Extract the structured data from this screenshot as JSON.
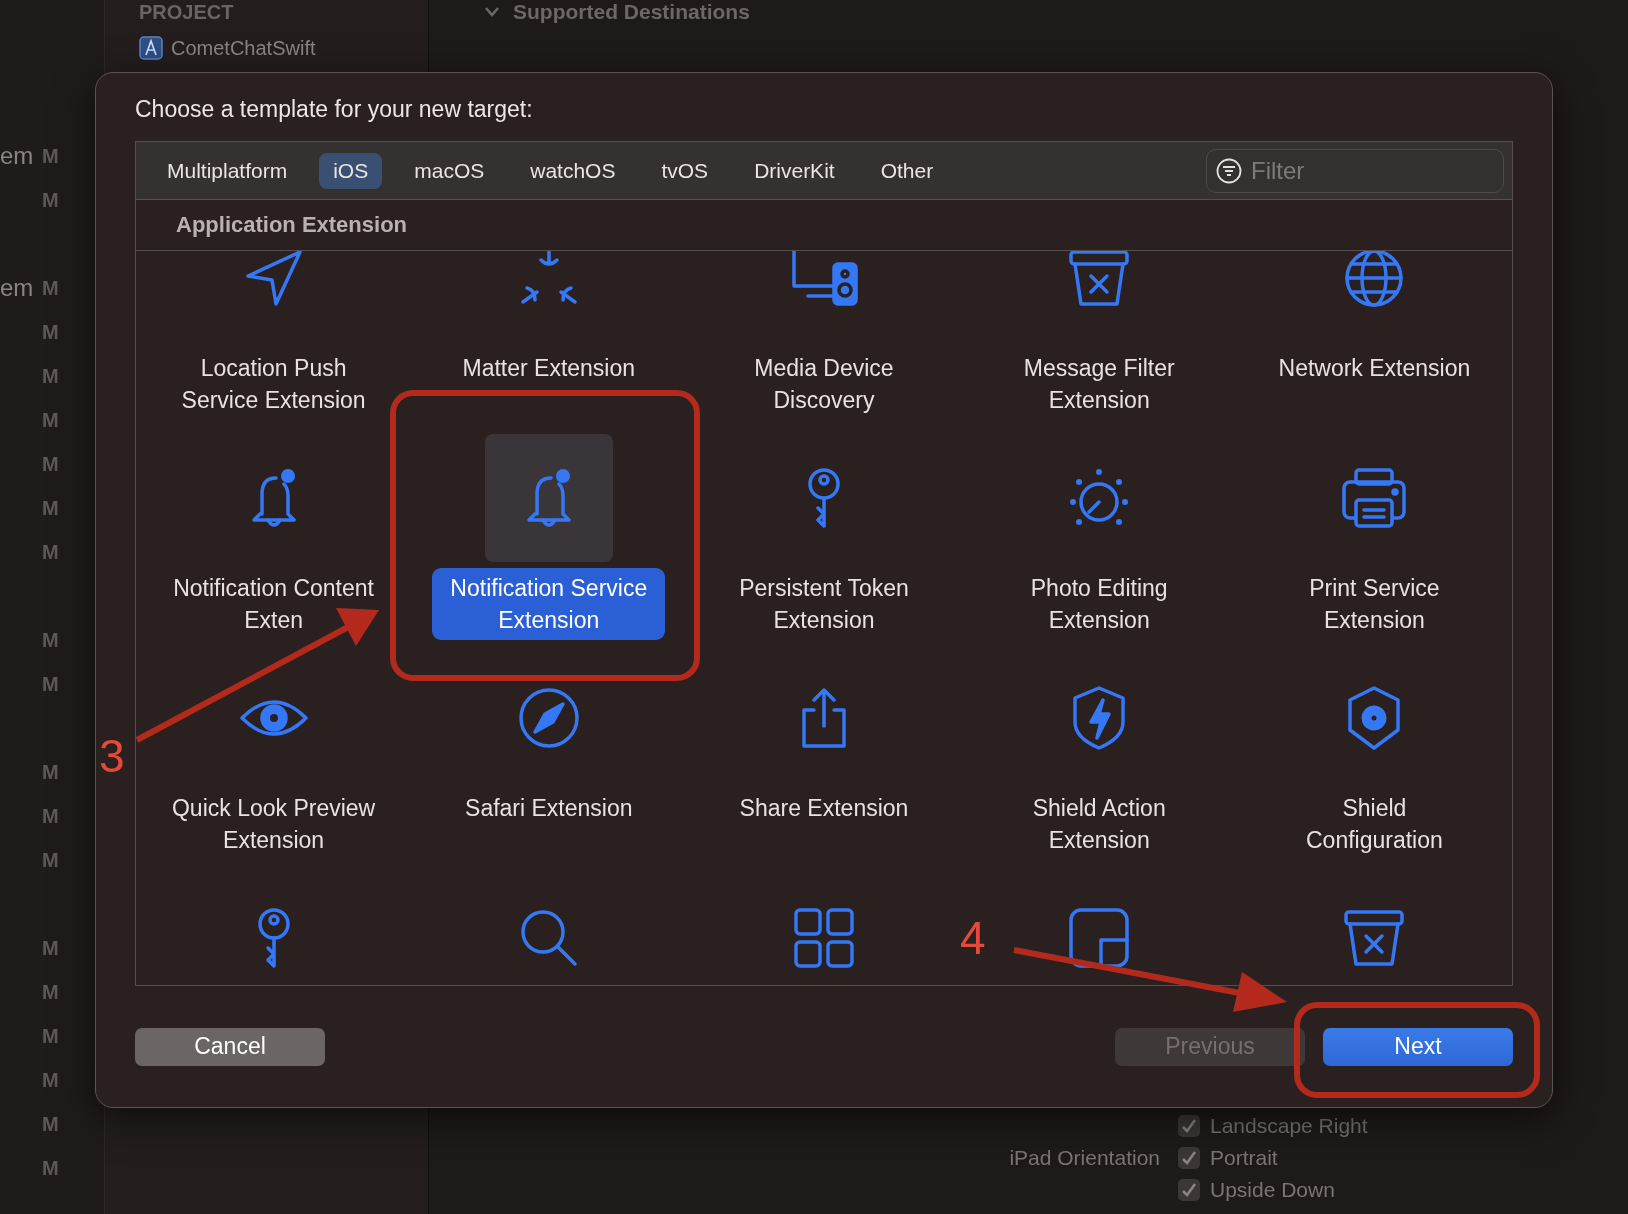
{
  "background": {
    "left_groups": [
      [
        {
          "name": "em",
          "status": "M"
        },
        {
          "status": "M"
        }
      ],
      [
        {
          "name": "em",
          "status": "M"
        },
        {
          "status": "M"
        },
        {
          "status": "M"
        },
        {
          "status": "M"
        },
        {
          "status": "M"
        },
        {
          "status": "M"
        },
        {
          "status": "M"
        }
      ],
      [
        {
          "status": "M"
        },
        {
          "status": "M"
        }
      ],
      [
        {
          "status": "M"
        },
        {
          "status": "M"
        },
        {
          "status": "M"
        }
      ],
      [
        {
          "status": "M"
        },
        {
          "status": "M"
        },
        {
          "status": "M"
        },
        {
          "status": "M"
        },
        {
          "status": "M"
        },
        {
          "status": "M"
        }
      ]
    ],
    "sidebar_header": "PROJECT",
    "sidebar_item": "CometChatSwift",
    "section_title": "Supported Destinations",
    "settings": [
      {
        "option": "Landscape Right",
        "checked": true
      },
      {
        "label": "iPad Orientation",
        "option": "Portrait",
        "checked": true
      },
      {
        "option": "Upside Down",
        "checked": true
      }
    ]
  },
  "dialog": {
    "title": "Choose a template for your new target:",
    "tabs": [
      {
        "label": "Multiplatform",
        "selected": false
      },
      {
        "label": "iOS",
        "selected": true
      },
      {
        "label": "macOS",
        "selected": false
      },
      {
        "label": "watchOS",
        "selected": false
      },
      {
        "label": "tvOS",
        "selected": false
      },
      {
        "label": "DriverKit",
        "selected": false
      },
      {
        "label": "Other",
        "selected": false
      }
    ],
    "filter": {
      "placeholder": "Filter"
    },
    "section": "Application Extension",
    "templates": [
      {
        "kind": "location",
        "label": "Location Push Service Extension",
        "selected": false
      },
      {
        "kind": "matter",
        "label": "Matter Extension",
        "selected": false
      },
      {
        "kind": "media",
        "label": "Media Device Discovery",
        "selected": false
      },
      {
        "kind": "bin",
        "label": "Message Filter Extension",
        "selected": false
      },
      {
        "kind": "globe",
        "label": "Network Extension",
        "selected": false
      },
      {
        "kind": "bell",
        "label": "Notification Content Exten",
        "selected": false
      },
      {
        "kind": "bell",
        "label": "Notification Service Extension",
        "selected": true
      },
      {
        "kind": "key",
        "label": "Persistent Token Extension",
        "selected": false
      },
      {
        "kind": "dial",
        "label": "Photo Editing Extension",
        "selected": false
      },
      {
        "kind": "printer",
        "label": "Print Service Extension",
        "selected": false
      },
      {
        "kind": "eye",
        "label": "Quick Look Preview Extension",
        "selected": false
      },
      {
        "kind": "compass",
        "label": "Safari Extension",
        "selected": false
      },
      {
        "kind": "share",
        "label": "Share Extension",
        "selected": false
      },
      {
        "kind": "shieldbolt",
        "label": "Shield Action Extension",
        "selected": false
      },
      {
        "kind": "shieldgear",
        "label": "Shield Configuration",
        "selected": false
      },
      {
        "kind": "key",
        "selected": false
      },
      {
        "kind": "search",
        "selected": false
      },
      {
        "kind": "grid",
        "selected": false
      },
      {
        "kind": "widget",
        "selected": false
      },
      {
        "kind": "bin",
        "selected": false
      }
    ],
    "buttons": [
      {
        "label": "Cancel",
        "kind": "plain",
        "disabled": false
      },
      {
        "label": "Previous",
        "kind": "plain",
        "disabled": true
      },
      {
        "label": "Next",
        "kind": "default",
        "disabled": false
      }
    ]
  },
  "annotations": [
    {
      "label": "3"
    },
    {
      "label": "4"
    }
  ]
}
